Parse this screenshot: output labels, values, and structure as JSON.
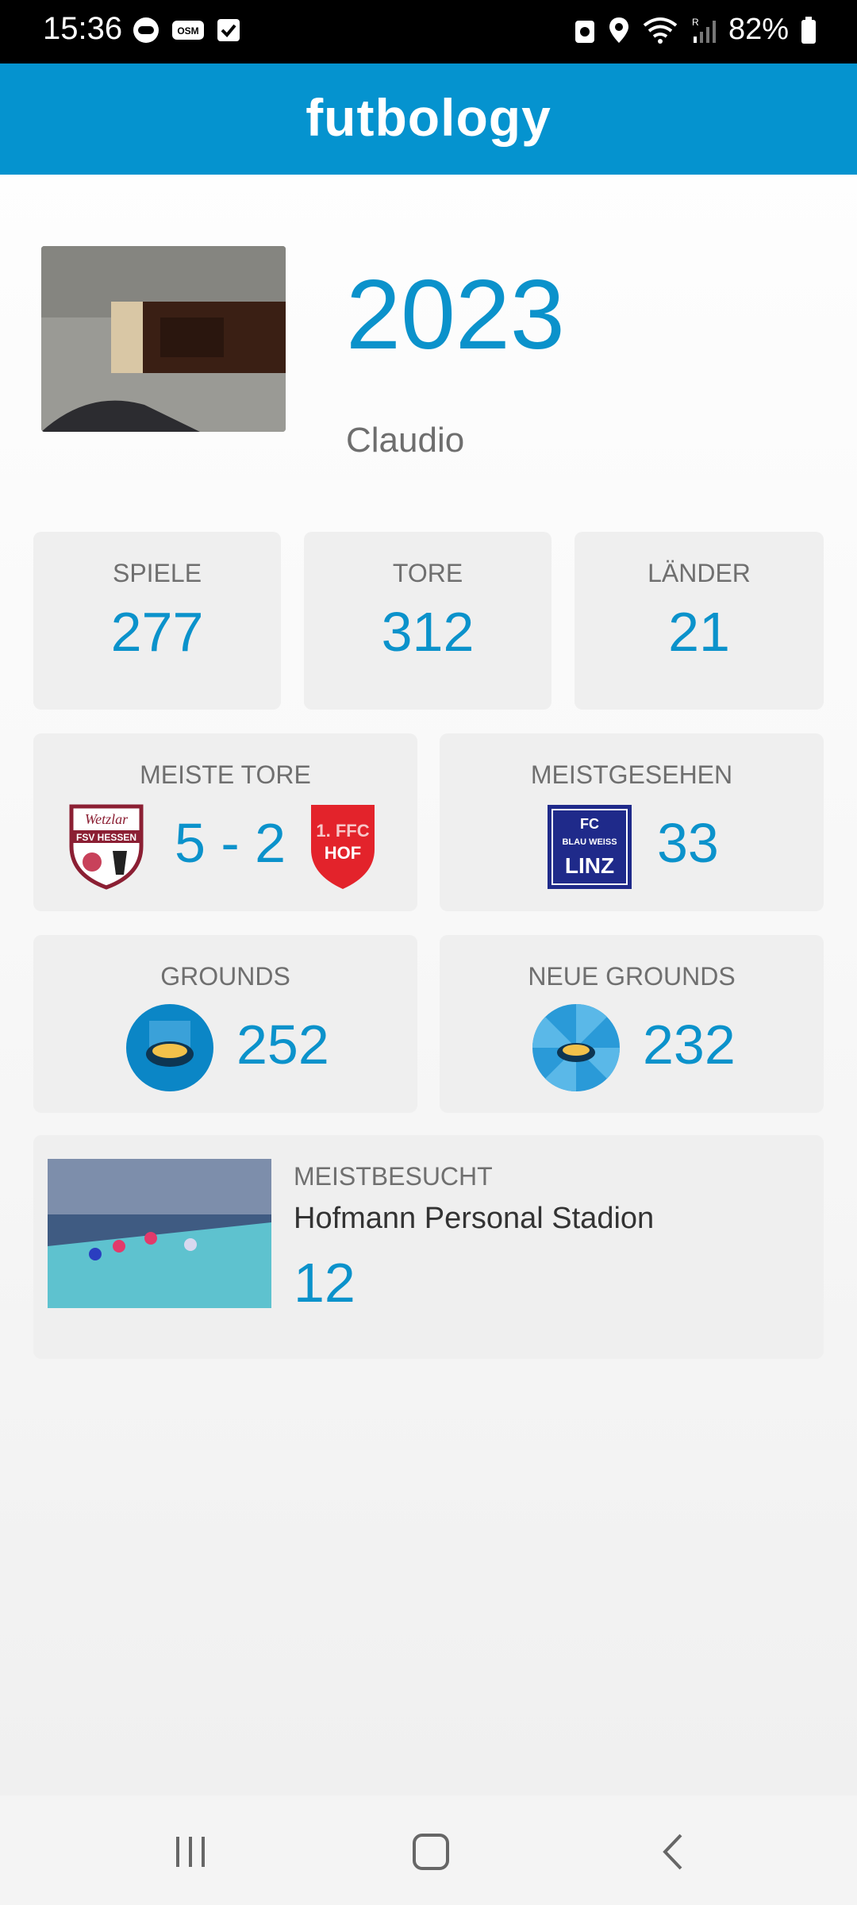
{
  "status_bar": {
    "time": "15:36",
    "battery": "82%",
    "left_icons": [
      "samsung-health-icon",
      "osm-icon",
      "check-icon"
    ],
    "right_icons": [
      "recycle-icon",
      "location-icon",
      "wifi-icon",
      "signal-icon",
      "battery-icon"
    ]
  },
  "app": {
    "title": "futbology"
  },
  "profile": {
    "year": "2023",
    "name": "Claudio"
  },
  "stats": {
    "spiele": {
      "label": "SPIELE",
      "value": "277"
    },
    "tore": {
      "label": "TORE",
      "value": "312"
    },
    "laender": {
      "label": "LÄNDER",
      "value": "21"
    }
  },
  "meiste_tore": {
    "label": "MEISTE TORE",
    "score": "5 - 2",
    "home_badge_text": "FSV HESSEN",
    "home_badge_script": "Wetzlar",
    "away_badge_text": [
      "1. FFC",
      "HOF"
    ]
  },
  "meistgesehen": {
    "label": "MEISTGESEHEN",
    "value": "33",
    "badge_text": [
      "FC",
      "BLAU WEISS",
      "LINZ"
    ]
  },
  "grounds": {
    "label": "GROUNDS",
    "value": "252"
  },
  "neue_grounds": {
    "label": "NEUE GROUNDS",
    "value": "232"
  },
  "meistbesucht": {
    "label": "MEISTBESUCHT",
    "stadium": "Hofmann Personal Stadion",
    "value": "12"
  },
  "colors": {
    "accent": "#0b92cb",
    "appbar": "#0593cf",
    "card": "#efefef"
  }
}
